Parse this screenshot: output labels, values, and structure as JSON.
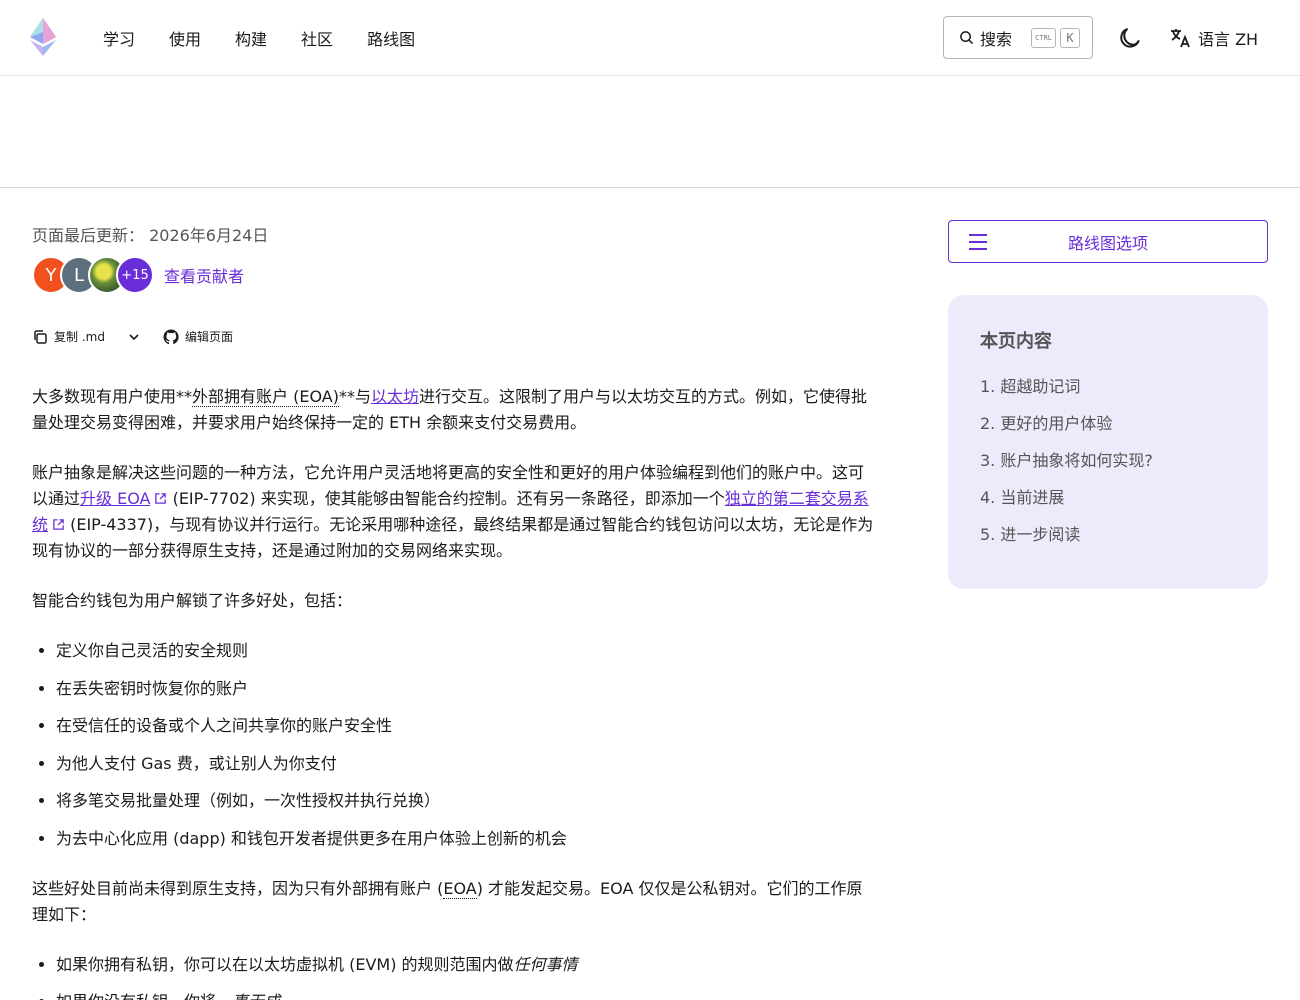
{
  "header": {
    "nav": [
      "学习",
      "使用",
      "构建",
      "社区",
      "路线图"
    ],
    "search_label": "搜索",
    "kbd_ctrl": "CTRL",
    "kbd_k": "K",
    "lang_label": "语言 ZH"
  },
  "meta": {
    "updated": "页面最后更新： 2026年6月24日",
    "avatars": [
      "Y",
      "L",
      "",
      "+15"
    ],
    "contributors_link": "查看贡献者"
  },
  "toolbar": {
    "copy_label": "复制 .md",
    "edit_label": "编辑页面"
  },
  "article": {
    "p1_a": "大多数现有用户使用**",
    "p1_abbr": "外部拥有账户 (EOA)",
    "p1_b": "**与",
    "p1_link": "以太坊",
    "p1_c": "进行交互。这限制了用户与以太坊交互的方式。例如，它使得批量处理交易变得困难，并要求用户始终保持一定的 ETH 余额来支付交易费用。",
    "p2_a": "账户抽象是解决这些问题的一种方法，它允许用户灵活地将更高的安全性和更好的用户体验编程到他们的账户中。这可以通过",
    "p2_link1": "升级 EOA",
    "p2_b": " (EIP-7702) 来实现，使其能够由智能合约控制。还有另一条路径，即添加一个",
    "p2_link2": "独立的第二套交易系统",
    "p2_c": " (EIP-4337)，与现有协议并行运行。无论采用哪种途径，最终结果都是通过智能合约钱包访问以太坊，无论是作为现有协议的一部分获得原生支持，还是通过附加的交易网络来实现。",
    "p3": "智能合约钱包为用户解锁了许多好处，包括：",
    "list1": [
      "定义你自己灵活的安全规则",
      "在丢失密钥时恢复你的账户",
      "在受信任的设备或个人之间共享你的账户安全性",
      "为他人支付 Gas 费，或让别人为你支付",
      "将多笔交易批量处理（例如，一次性授权并执行兑换）",
      "为去中心化应用 (dapp) 和钱包开发者提供更多在用户体验上创新的机会"
    ],
    "p4_a": "这些好处目前尚未得到原生支持，因为只有外部拥有账户 (",
    "p4_abbr": "EOA",
    "p4_b": ") 才能发起交易。EOA 仅仅是公私钥对。它们的工作原理如下：",
    "list2_1_a": "如果你拥有私钥，你可以在以太坊虚拟机 (EVM) 的规则范围内做",
    "list2_1_em": "任何事情",
    "list2_2_a": "如果你没有私钥，你将",
    "list2_2_em": "一事无成"
  },
  "sidebar": {
    "roadmap_label": "路线图选项",
    "toc_title": "本页内容",
    "toc": [
      "1. 超越助记词",
      "2. 更好的用户体验",
      "3. 账户抽象将如何实现?",
      "4. 当前进展",
      "5. 进一步阅读"
    ]
  },
  "colors": {
    "accent": "#6a2ed8",
    "toc_bg": "#ecebfb"
  }
}
